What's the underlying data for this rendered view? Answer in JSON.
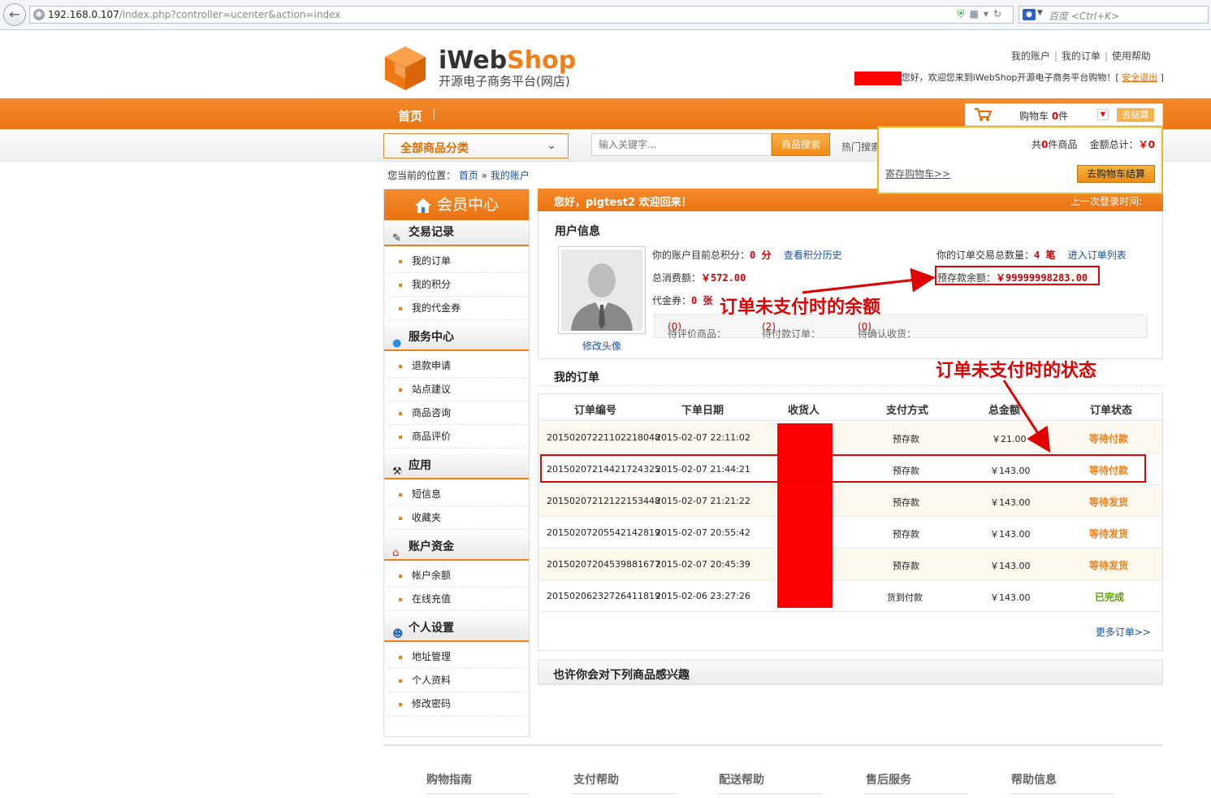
{
  "browser": {
    "url_host": "192.168.0.107",
    "url_path": "/index.php?controller=ucenter&action=index",
    "search_placeholder": "百度 <Ctrl+K>"
  },
  "header": {
    "logo_text_i": "iWeb",
    "logo_text_shop": "Shop",
    "logo_sub": "开源电子商务平台(网店)",
    "toplinks": [
      "我的账户",
      "我的订单",
      "使用帮助"
    ],
    "welcome_text": "您好，欢迎您来到iWebShop开源电子商务平台购物！[",
    "logout": "安全退出",
    "welcome_end": "]"
  },
  "nav": {
    "home": "首页",
    "sep": "|",
    "cart_label": "购物车",
    "cart_count": "0",
    "cart_unit": "件",
    "checkout": "去结算"
  },
  "search": {
    "category": "全部商品分类",
    "placeholder": "输入关键字...",
    "button": "商品搜索",
    "hot": "热门搜索"
  },
  "cart_popup": {
    "total_prefix": "共",
    "total_count": "0",
    "total_suffix": "件商品",
    "amount_label": "金额总计：",
    "amount": "￥0",
    "save": "寄存购物车>>",
    "go": "去购物车结算"
  },
  "breadcrumb": {
    "prefix": "您当前的位置：",
    "home": "首页",
    "arrow": "»",
    "current": "我的账户"
  },
  "sidebar": {
    "title": "会员中心",
    "sections": [
      {
        "title": "交易记录",
        "items": [
          "我的订单",
          "我的积分",
          "我的代金券"
        ]
      },
      {
        "title": "服务中心",
        "items": [
          "退款申请",
          "站点建议",
          "商品咨询",
          "商品评价"
        ]
      },
      {
        "title": "应用",
        "items": [
          "短信息",
          "收藏夹"
        ]
      },
      {
        "title": "账户资金",
        "items": [
          "帐户余额",
          "在线充值"
        ]
      },
      {
        "title": "个人设置",
        "items": [
          "地址管理",
          "个人资料",
          "修改密码"
        ]
      }
    ]
  },
  "main": {
    "hello": "您好，pigtest2 欢迎回来！",
    "last_login": "上一次登录时间:",
    "user_info_title": "用户信息",
    "avatar_link": "修改头像",
    "points_label": "你的账户目前总积分：",
    "points_value": "0 分",
    "points_link": "查看积分历史",
    "spend_label": "总消费额：",
    "spend_value": "￥572.00",
    "voucher_label": "代金券：",
    "voucher_value": "0 张",
    "order_total_label": "你的订单交易总数量：",
    "order_total_value": "4 笔",
    "order_list_link": "进入订单列表",
    "balance_label": "预存款余额：",
    "balance_value": "￥99999998283.00",
    "stats": {
      "review_label": "待评价商品：",
      "review_value": "(0)",
      "unpaid_label": "待付款订单：",
      "unpaid_value": "(2)",
      "confirm_label": "待确认收货：",
      "confirm_value": "(0)"
    }
  },
  "annotations": {
    "balance_note": "订单未支付时的余额",
    "status_note": "订单未支付时的状态"
  },
  "orders": {
    "title": "我的订单",
    "columns": [
      "订单编号",
      "下单日期",
      "收货人",
      "支付方式",
      "总金额",
      "订单状态"
    ],
    "rows": [
      {
        "no": "20150207221102218048",
        "date": "2015-02-07 22:11:02",
        "pay": "预存款",
        "amount": "￥21.00",
        "status": "等待付款",
        "status_type": "pending"
      },
      {
        "no": "20150207214421724325",
        "date": "2015-02-07 21:44:21",
        "pay": "预存款",
        "amount": "￥143.00",
        "status": "等待付款",
        "status_type": "pending"
      },
      {
        "no": "20150207212122153448",
        "date": "2015-02-07 21:21:22",
        "pay": "预存款",
        "amount": "￥143.00",
        "status": "等待发货",
        "status_type": "pending"
      },
      {
        "no": "20150207205542142819",
        "date": "2015-02-07 20:55:42",
        "pay": "预存款",
        "amount": "￥143.00",
        "status": "等待发货",
        "status_type": "pending"
      },
      {
        "no": "20150207204539881677",
        "date": "2015-02-07 20:45:39",
        "pay": "预存款",
        "amount": "￥143.00",
        "status": "等待发货",
        "status_type": "pending"
      },
      {
        "no": "20150206232726411819",
        "date": "2015-02-06 23:27:26",
        "pay": "货到付款",
        "amount": "￥143.00",
        "status": "已完成",
        "status_type": "done"
      }
    ],
    "more": "更多订单>>"
  },
  "interest": "也许你会对下列商品感兴趣",
  "footer": [
    "购物指南",
    "支付帮助",
    "配送帮助",
    "售后服务",
    "帮助信息"
  ],
  "colors": {
    "brand_orange": "#f07f1a",
    "annotation_red": "#e00000",
    "status_done": "#57a400"
  }
}
